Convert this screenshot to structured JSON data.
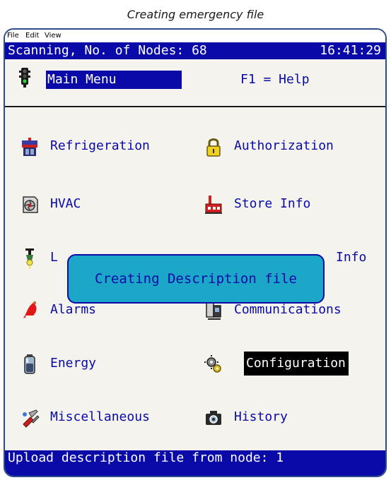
{
  "caption": "Creating emergency file",
  "menubar": {
    "file": "File",
    "edit": "Edit",
    "view": "View"
  },
  "status_top": {
    "left": "Scanning, No. of Nodes: 68",
    "time": "16:41:29"
  },
  "main_menu": {
    "title": "Main Menu",
    "help": "F1 = Help"
  },
  "menu_items": {
    "refrigeration": "Refrigeration",
    "authorization": "Authorization",
    "hvac": "HVAC",
    "store_info": "Store Info",
    "lighting_partial": "L",
    "info_partial": "Info",
    "alarms": "Alarms",
    "communications": "Communications",
    "energy": "Energy",
    "configuration": "Configuration",
    "miscellaneous": "Miscellaneous",
    "history": "History"
  },
  "popup": {
    "text": "Creating Description file"
  },
  "status_bottom": {
    "text": "Upload description file from node: 1"
  },
  "colors": {
    "screen_blue": "#0a0aa8",
    "popup_cyan": "#1ca6c8",
    "selection_black": "#000000",
    "frame_border": "#2c4d8c"
  },
  "icons": {
    "traffic": "traffic-light-icon",
    "refrigeration": "refrigeration-unit-icon",
    "authorization": "padlock-icon",
    "hvac": "fan-icon",
    "store_info": "store-building-icon",
    "lighting": "light-bulb-icon",
    "alarms": "alarm-bell-icon",
    "communications": "network-computer-icon",
    "energy": "battery-icon",
    "configuration": "gears-icon",
    "miscellaneous": "tools-icon",
    "history": "camera-icon"
  }
}
